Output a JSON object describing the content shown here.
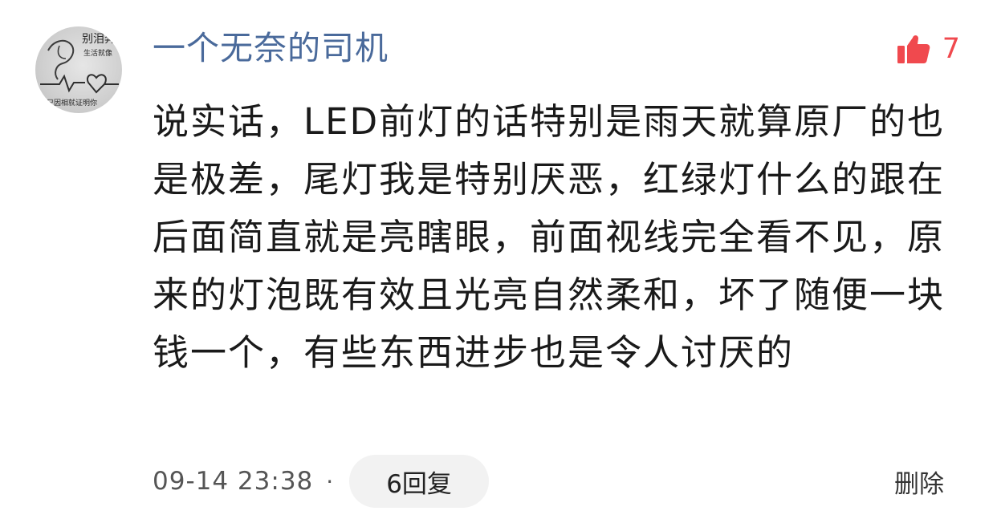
{
  "comment": {
    "username": "一个无奈的司机",
    "avatar_text": {
      "line1": "别泪奔",
      "line2": "生活就像",
      "line3": "只因相就证明你"
    },
    "like_icon": "thumbs-up-icon",
    "like_count": "7",
    "body": "说实话，LED前灯的话特别是雨天就算原厂的也是极差，尾灯我是特别厌恶，红绿灯什么的跟在后面简直就是亮瞎眼，前面视线完全看不见，原来的灯泡既有效且光亮自然柔和，坏了随便一块钱一个，有些东西进步也是令人讨厌的",
    "timestamp": "09-14 23:38",
    "separator": "·",
    "reply_label": "6回复",
    "delete_label": "删除"
  },
  "colors": {
    "username": "#4a6a9b",
    "like": "#f0494e",
    "reply_pill_bg": "#f2f2f2"
  }
}
